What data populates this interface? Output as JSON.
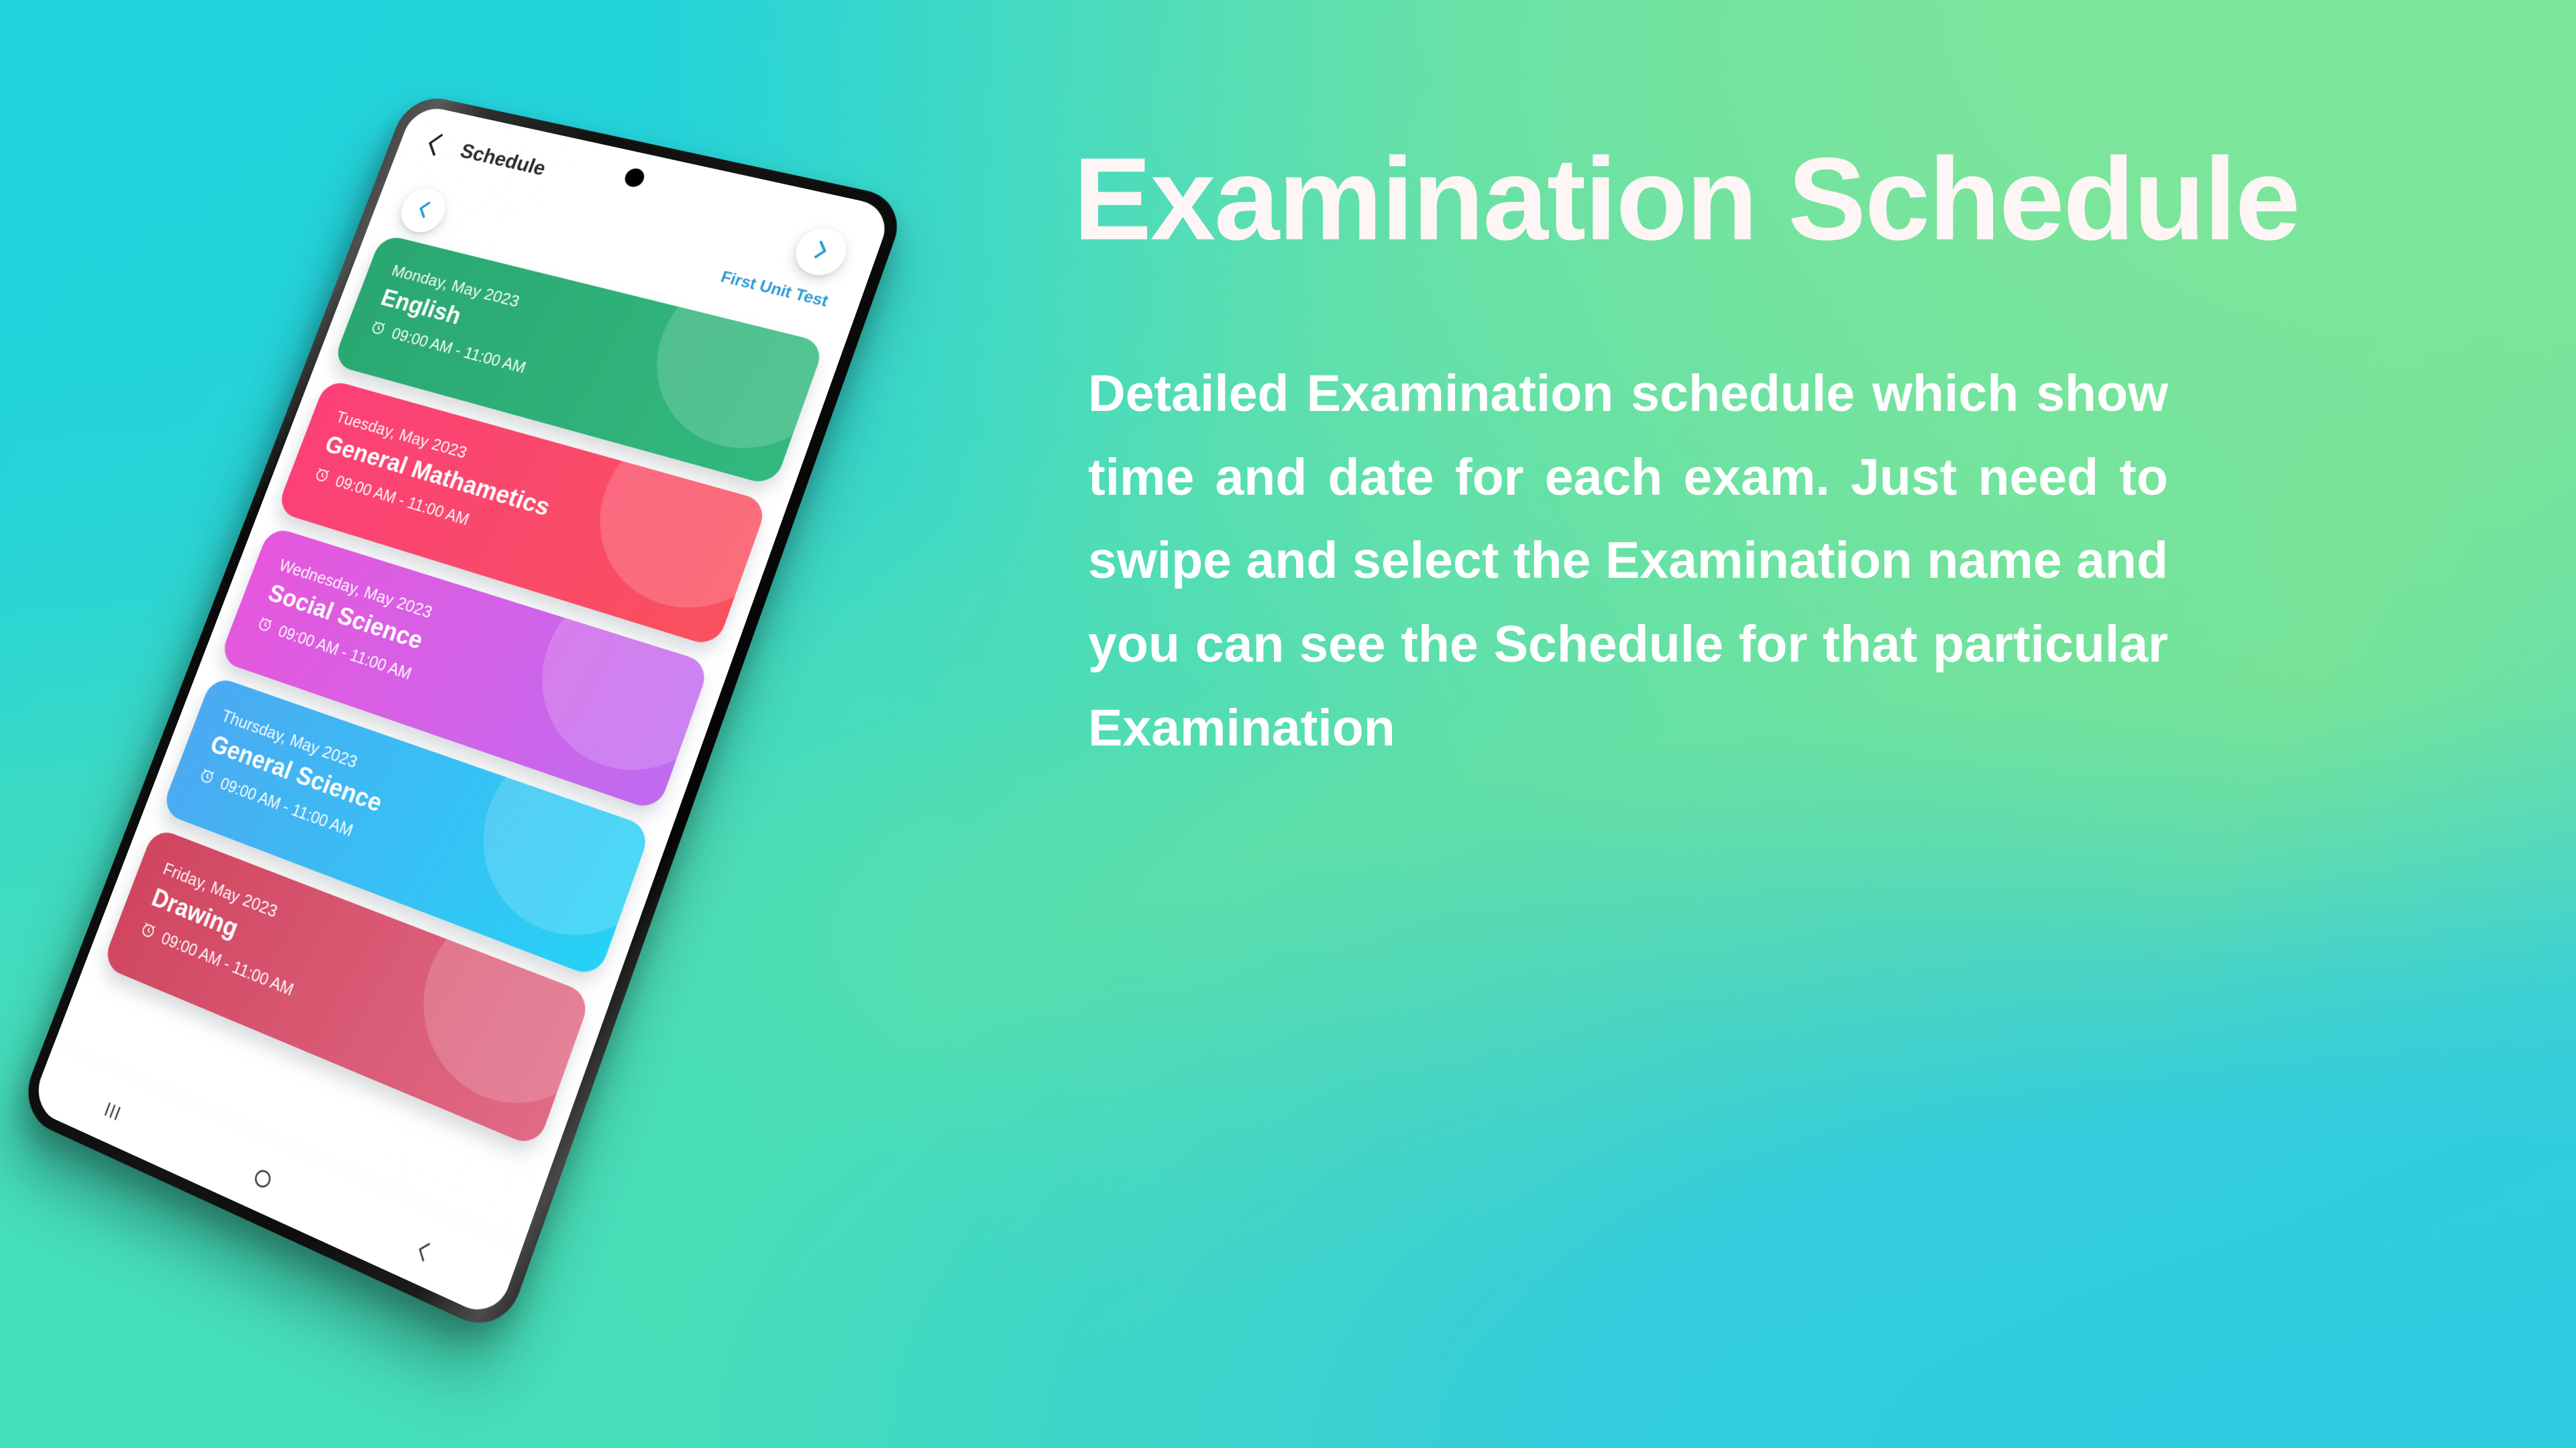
{
  "background": {
    "colors": [
      "#23D3D8",
      "#3ED9C4",
      "#63E0A6",
      "#74E296",
      "#2FCBE0"
    ]
  },
  "promo": {
    "headline": "Examination Schedule",
    "body": "Detailed Examination schedule which show time and date for each exam. Just need to swipe and select the Examination name and you can see the Schedule for that particular Examination",
    "headline_color": "#FDF6F4",
    "body_color": "#FFFFFF"
  },
  "phone": {
    "appbar": {
      "back_icon": "chevron-left-icon",
      "title": "Schedule"
    },
    "exam_selector": {
      "name": "First Unit Test",
      "name_color": "#2B9BD4",
      "prev_icon": "chevron-left-icon",
      "next_icon": "chevron-right-icon"
    },
    "clock_icon": "alarm-clock-icon",
    "cards": [
      {
        "date": "Monday, May 2023",
        "subject": "English",
        "time": "09:00 AM - 11:00 AM",
        "color_start": "#2AA771",
        "color_end": "#32B97E"
      },
      {
        "date": "Tuesday, May 2023",
        "subject": "General Mathametics",
        "time": "09:00 AM - 11:00 AM",
        "color_start": "#FB4078",
        "color_end": "#F9515E"
      },
      {
        "date": "Wednesday, May 2023",
        "subject": "Social Science",
        "time": "09:00 AM - 11:00 AM",
        "color_start": "#E657DC",
        "color_end": "#C06BF0"
      },
      {
        "date": "Thursday, May 2023",
        "subject": "General Science",
        "time": "09:00 AM - 11:00 AM",
        "color_start": "#4CA9F2",
        "color_end": "#26D2F5"
      },
      {
        "date": "Friday, May 2023",
        "subject": "Drawing",
        "time": "09:00 AM - 11:00 AM",
        "color_start": "#D0455F",
        "color_end": "#E06A84"
      }
    ],
    "navbar": {
      "recents_icon": "recents-icon",
      "home_icon": "home-circle-icon",
      "back_icon": "chevron-left-icon"
    }
  }
}
